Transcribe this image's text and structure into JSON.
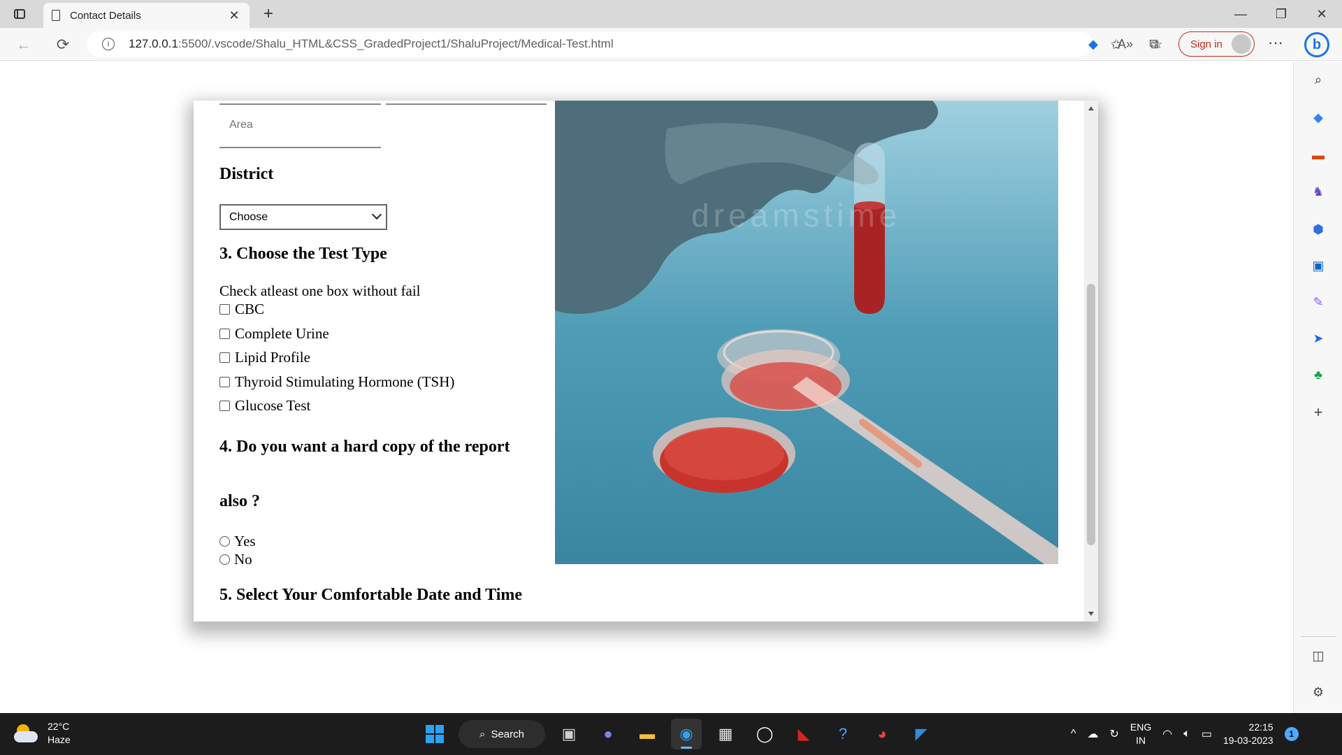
{
  "browser": {
    "tab_title": "Contact Details",
    "url_host": "127.0.0.1",
    "url_path": ":5500/.vscode/Shalu_HTML&CSS_GradedProject1/ShaluProject/Medical-Test.html",
    "sign_in_label": "Sign in",
    "accent_color": "#c42b1c"
  },
  "form": {
    "area_placeholder": "Area",
    "district_heading": "District",
    "district_select_value": "Choose",
    "q3_heading": "3. Choose the Test Type",
    "q3_note": "Check atleast one box without fail",
    "tests": [
      "CBC",
      "Complete Urine",
      "Lipid Profile",
      "Thyroid Stimulating Hormone (TSH)",
      "Glucose Test"
    ],
    "q4_heading_line1": "4. Do you want a hard copy of the report",
    "q4_heading_line2": "also ?",
    "hardcopy_options": [
      "Yes",
      "No"
    ],
    "q5_heading": "5. Select Your Comfortable Date and Time"
  },
  "image": {
    "watermark": "dreamstime"
  },
  "taskbar": {
    "temperature": "22°C",
    "weather": "Haze",
    "search_label": "Search",
    "lang_line1": "ENG",
    "lang_line2": "IN",
    "time": "22:15",
    "date": "19-03-2023",
    "notification_count": "1"
  }
}
